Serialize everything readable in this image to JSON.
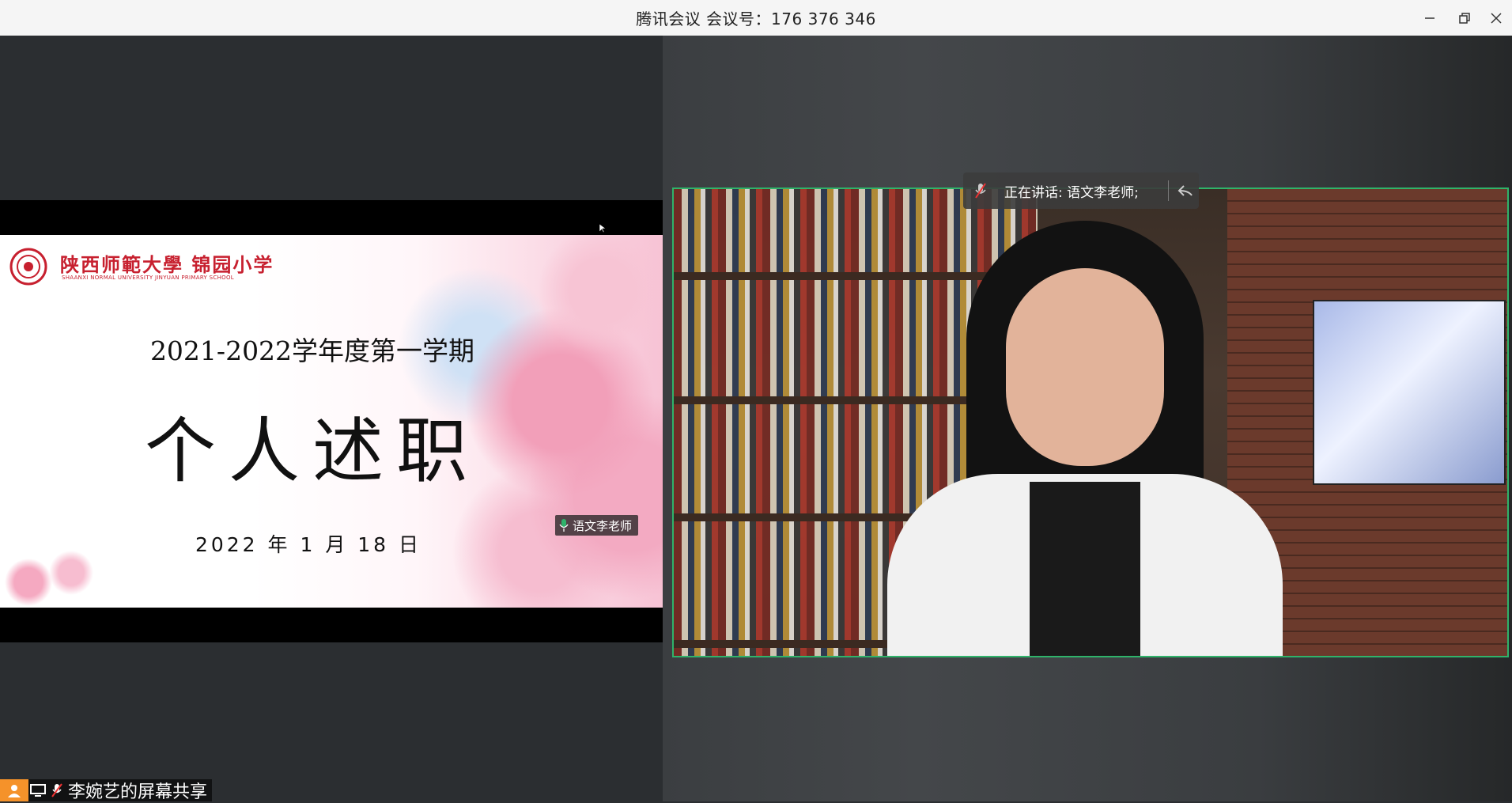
{
  "window": {
    "title": "腾讯会议 会议号：176 376 346",
    "minimize_icon": "minimize-icon",
    "restore_icon": "restore-icon",
    "close_icon": "close-icon"
  },
  "slide": {
    "school_name_cn": "陕西师範大學  锦园小学",
    "school_name_en": "SHAANXI NORMAL UNIVERSITY JINYUAN PRIMARY SCHOOL",
    "term": "2021-2022学年度第一学期",
    "title": "个人述职",
    "date": "2022 年 1 月 18 日"
  },
  "share": {
    "label": "李婉艺的屏幕共享",
    "avatar_color": "#f5922a"
  },
  "video": {
    "speaking_label": "正在讲话: 语文李老师;",
    "participant_name": "语文李老师",
    "active_border_color": "#2fb36a"
  }
}
